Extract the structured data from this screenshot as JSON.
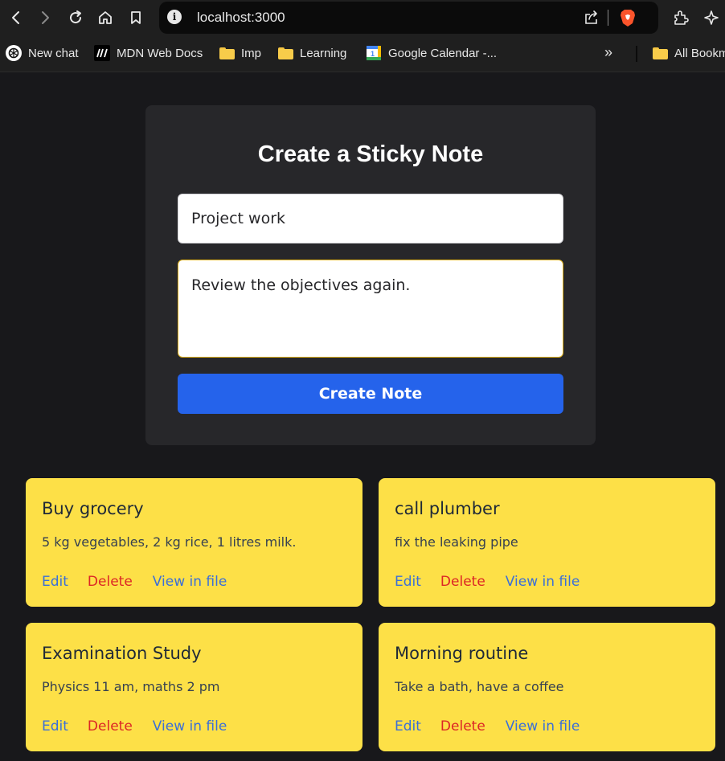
{
  "browser": {
    "url": "localhost:3000",
    "bookmarks": [
      {
        "label": "New chat",
        "icon": "chatgpt-icon"
      },
      {
        "label": "MDN Web Docs",
        "icon": "mdn-icon"
      },
      {
        "label": "Imp",
        "icon": "folder-icon"
      },
      {
        "label": "Learning",
        "icon": "folder-icon"
      },
      {
        "label": "Google Calendar -...",
        "icon": "google-calendar-icon"
      }
    ],
    "more_bookmarks": "»",
    "all_bookmarks": "All Bookm"
  },
  "form": {
    "title": "Create a Sticky Note",
    "title_value": "Project work",
    "content_value": "Review the objectives again.",
    "submit_label": "Create Note"
  },
  "notes": [
    {
      "title": "Buy grocery",
      "content": "5 kg vegetables, 2 kg rice, 1 litres milk."
    },
    {
      "title": "call plumber",
      "content": "fix the leaking pipe"
    },
    {
      "title": "Examination Study",
      "content": "Physics 11 am, maths 2 pm"
    },
    {
      "title": "Morning routine",
      "content": "Take a bath, have a coffee"
    }
  ],
  "note_actions": {
    "edit": "Edit",
    "delete": "Delete",
    "view": "View in file"
  },
  "colors": {
    "note_bg": "#fde047",
    "primary": "#2563eb",
    "delete": "#dc2626",
    "link": "#3b6fd8",
    "page_bg": "#18181b",
    "card_bg": "#27272a"
  }
}
